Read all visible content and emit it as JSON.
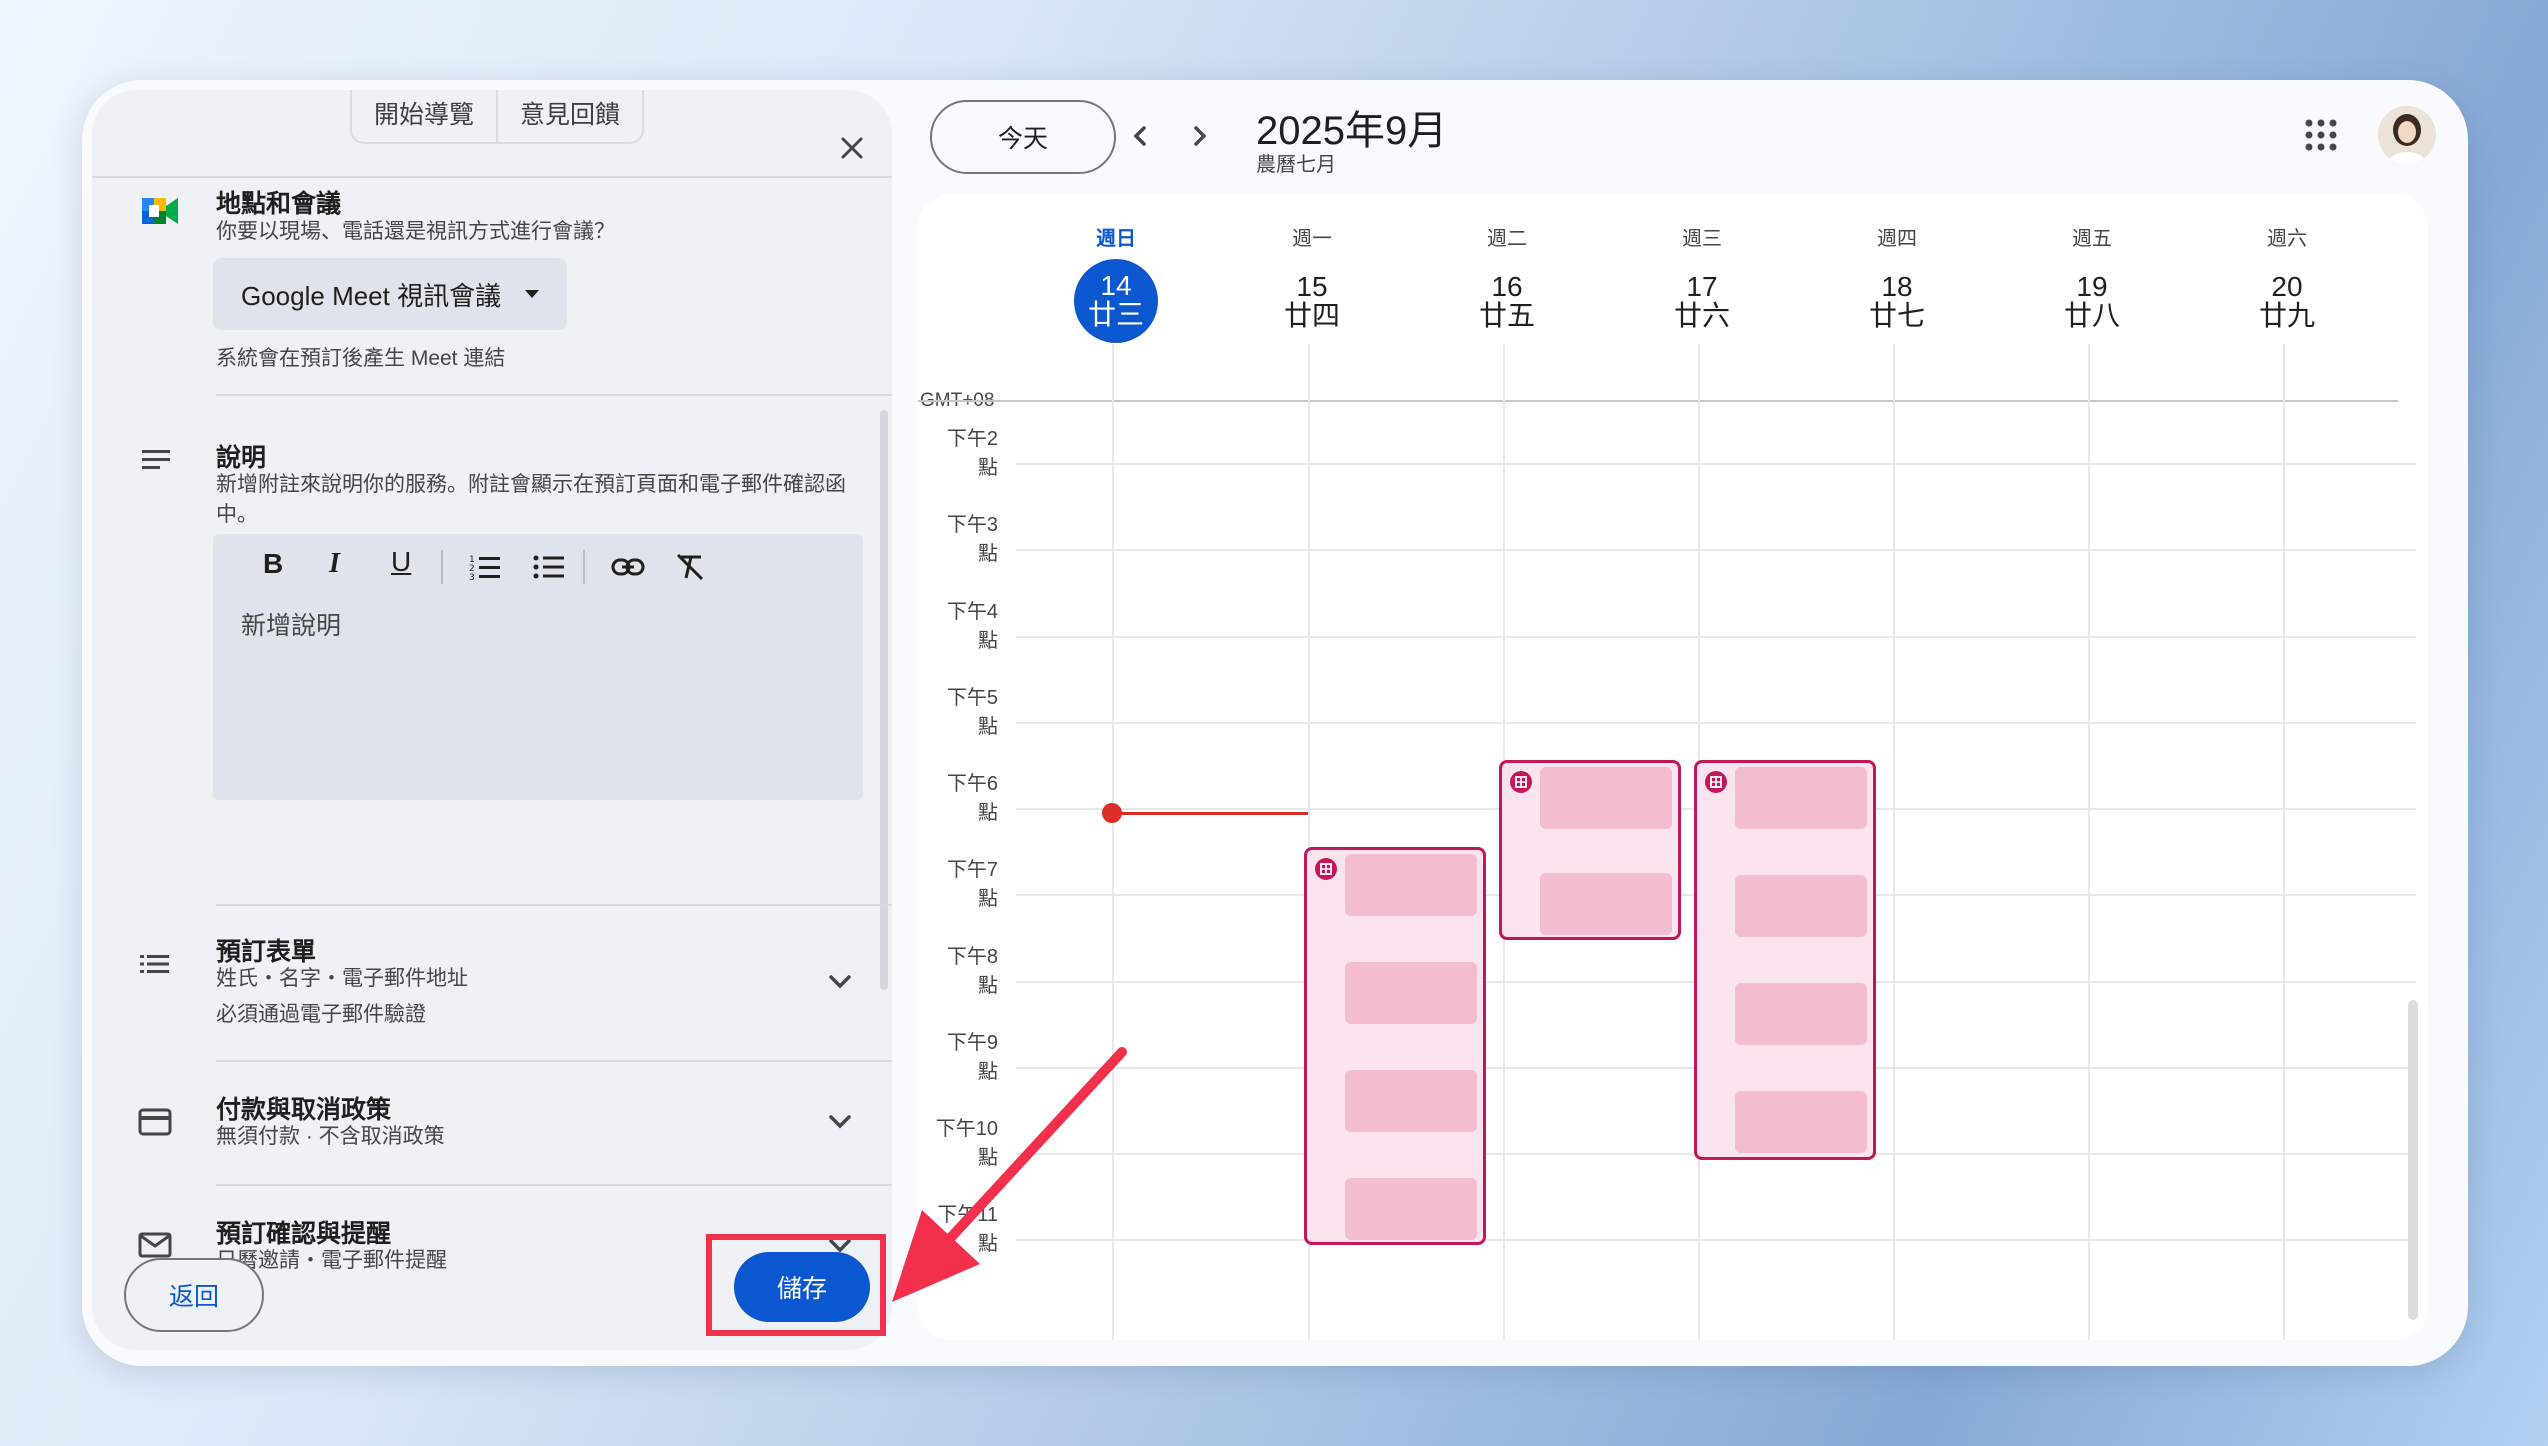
{
  "panel": {
    "top_buttons": [
      "開始導覽",
      "意見回饋"
    ],
    "location": {
      "title": "地點和會議",
      "subtitle": "你要以現場、電話還是視訊方式進行會議？",
      "dropdown": "Google Meet 視訊會議",
      "note": "系統會在預訂後產生 Meet 連結"
    },
    "description": {
      "title": "說明",
      "subtitle": "新增附註來說明你的服務。附註會顯示在預訂頁面和電子郵件確認函中。",
      "placeholder": "新增說明"
    },
    "booking_form": {
      "title": "預訂表單",
      "line1": "姓氏・名字・電子郵件地址",
      "line2": "必須通過電子郵件驗證"
    },
    "payment": {
      "title": "付款與取消政策",
      "line1": "無須付款 · 不含取消政策"
    },
    "confirmation": {
      "title": "預訂確認與提醒",
      "line1": "日曆邀請・電子郵件提醒"
    },
    "back_label": "返回",
    "save_label": "儲存"
  },
  "calendar": {
    "today_label": "今天",
    "title": "2025年9月",
    "subtitle": "農曆七月",
    "timezone": "GMT+08",
    "days": [
      {
        "dow": "週日",
        "num": "14",
        "lunar": "廿三",
        "today": true
      },
      {
        "dow": "週一",
        "num": "15",
        "lunar": "廿四"
      },
      {
        "dow": "週二",
        "num": "16",
        "lunar": "廿五"
      },
      {
        "dow": "週三",
        "num": "17",
        "lunar": "廿六"
      },
      {
        "dow": "週四",
        "num": "18",
        "lunar": "廿七"
      },
      {
        "dow": "週五",
        "num": "19",
        "lunar": "廿八"
      },
      {
        "dow": "週六",
        "num": "20",
        "lunar": "廿九"
      }
    ],
    "hours": [
      "下午2點",
      "下午3點",
      "下午4點",
      "下午5點",
      "下午6點",
      "下午7點",
      "下午8點",
      "下午9點",
      "下午10點",
      "下午11點"
    ]
  },
  "colors": {
    "accent_blue": "#0b57d0",
    "event_border": "#c2185b",
    "event_slot": "#f4bccf",
    "highlight_red": "#f2304b"
  }
}
